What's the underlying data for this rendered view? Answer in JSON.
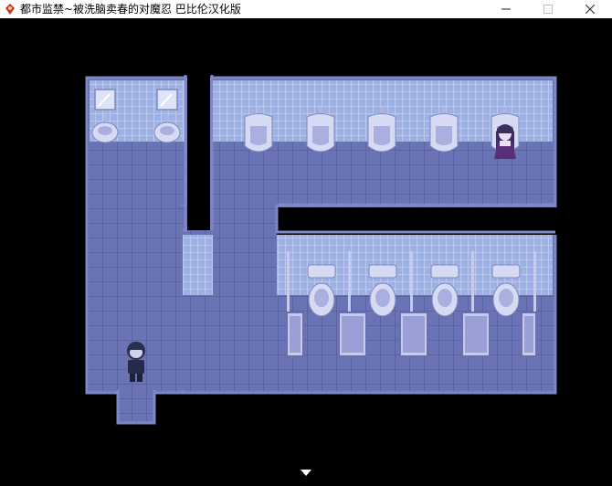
{
  "window": {
    "title": "都市监禁~被洗脑卖春的对魔忍 巴比伦汉化版",
    "icon": "game-app-icon",
    "controls": [
      "minimize-icon",
      "maximize-icon",
      "close-icon"
    ]
  },
  "scene": {
    "location": "restroom",
    "palette": {
      "floor": "#6a74b4",
      "floor_line": "#5a63a3",
      "wall_tile": "#9db1e4",
      "wall_tile_line": "#b9c8f0",
      "border": "#8088c4",
      "fixture": "#d6daf3",
      "background": "#000000"
    },
    "fixtures": {
      "sinks": 2,
      "mirrors": 2,
      "urinals": 5,
      "toilets": 4,
      "stall_doors": 5
    },
    "characters": [
      {
        "name": "player",
        "icon": "player-character-icon"
      },
      {
        "name": "girl-npc",
        "icon": "npc-character-icon"
      }
    ],
    "indicator": "continue-arrow-icon"
  }
}
